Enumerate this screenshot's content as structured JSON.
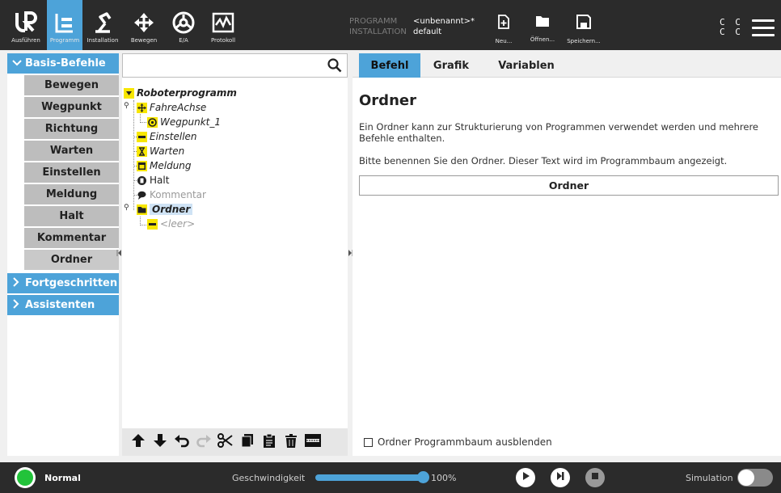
{
  "topbar": {
    "nav": [
      {
        "label": "Ausführen",
        "icon": "ur-logo-icon"
      },
      {
        "label": "Programm",
        "icon": "program-icon"
      },
      {
        "label": "Installation",
        "icon": "installation-icon"
      },
      {
        "label": "Bewegen",
        "icon": "move-icon"
      },
      {
        "label": "E/A",
        "icon": "io-icon"
      },
      {
        "label": "Protokoll",
        "icon": "log-icon"
      }
    ],
    "program_key": "PROGRAMM",
    "program_value": "<unbenannt>*",
    "installation_key": "INSTALLATION",
    "installation_value": "default",
    "file": {
      "new": "Neu...",
      "open": "Öffnen...",
      "save": "Speichern..."
    },
    "cc_line1": "C C",
    "cc_line2": "C C"
  },
  "palette": {
    "basic_header": "Basis-Befehle",
    "items": [
      "Bewegen",
      "Wegpunkt",
      "Richtung",
      "Warten",
      "Einstellen",
      "Meldung",
      "Halt",
      "Kommentar",
      "Ordner"
    ],
    "advanced_header": "Fortgeschritten",
    "wizards_header": "Assistenten"
  },
  "tree": {
    "root": "Roboterprogramm",
    "move": "FahreAchse",
    "waypoint": "Wegpunkt_1",
    "set": "Einstellen",
    "wait": "Warten",
    "popup": "Meldung",
    "halt": "Halt",
    "comment": "Kommentar",
    "folder": "Ordner",
    "empty": "<leer>"
  },
  "content": {
    "tabs": [
      "Befehl",
      "Grafik",
      "Variablen"
    ],
    "title": "Ordner",
    "desc1": "Ein Ordner kann zur Strukturierung von Programmen verwendet werden und mehrere Befehle enthalten.",
    "desc2": "Bitte benennen Sie den Ordner. Dieser Text wird im Programmbaum angezeigt.",
    "name_value": "Ordner",
    "hide_label": "Ordner Programmbaum ausblenden"
  },
  "bottombar": {
    "status": "Normal",
    "speed_label": "Geschwindigkeit",
    "speed_value": "100%",
    "speed_fraction": 1.0,
    "simulation_label": "Simulation"
  },
  "colors": {
    "accent": "#4da3d9",
    "topbar": "#2b2b2b",
    "power_green": "#22c33a"
  }
}
